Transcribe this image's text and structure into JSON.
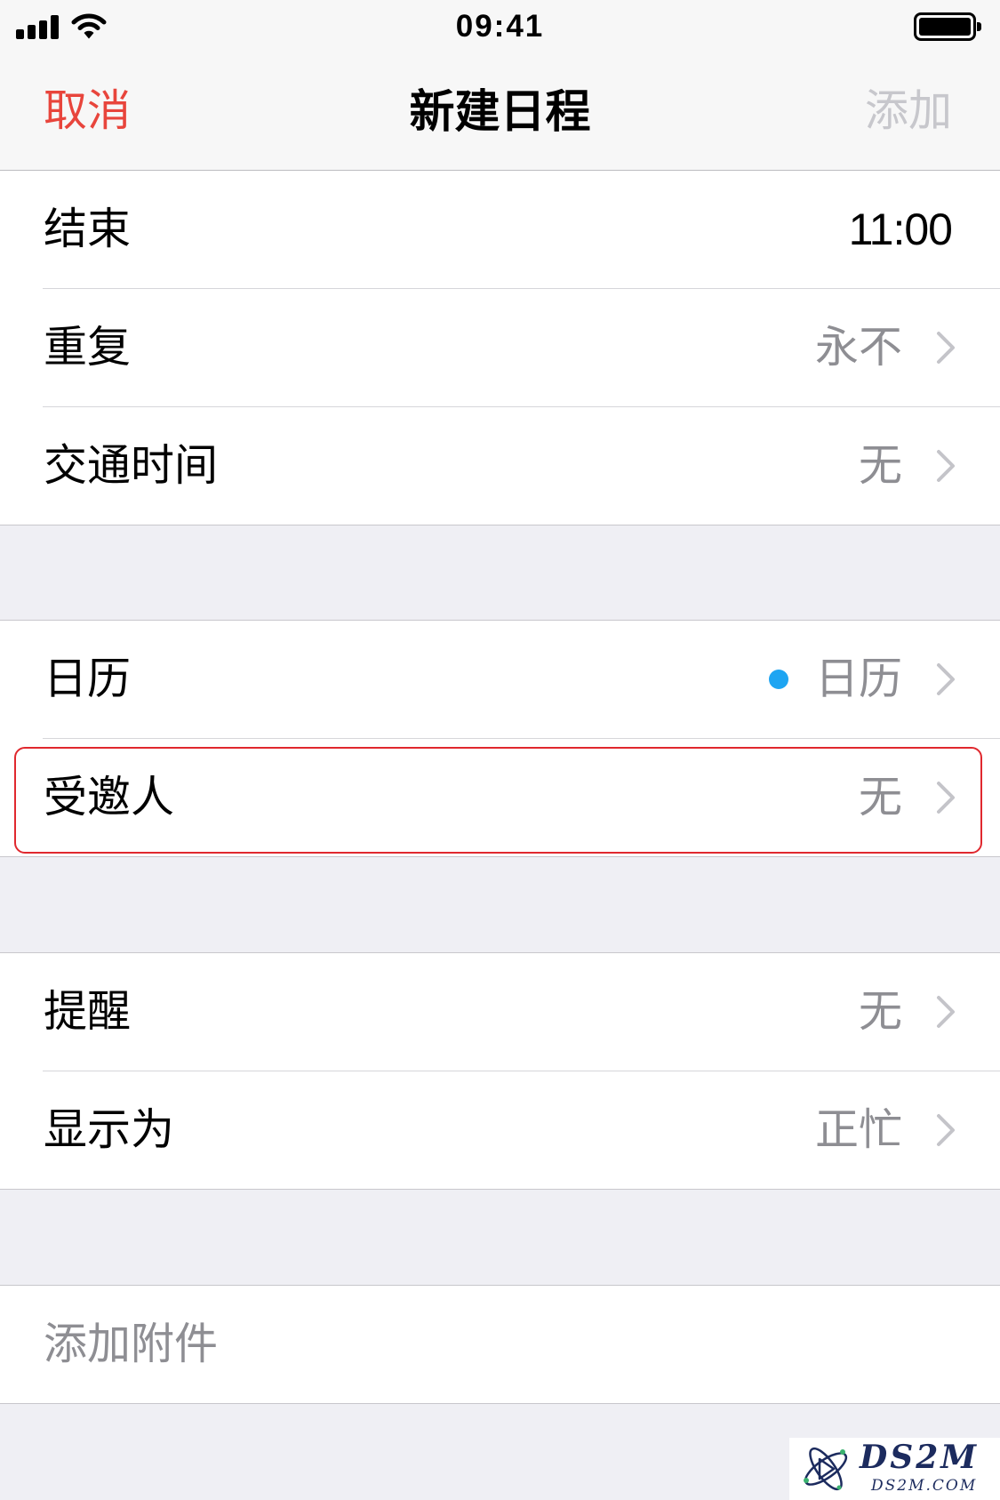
{
  "colors": {
    "accent_red": "#e8453c",
    "disabled_gray": "#c7c7cc",
    "value_gray": "#8e8e93",
    "calendar_dot": "#1ea5f2",
    "highlight_border": "#e0282e",
    "group_background": "#efeff4"
  },
  "status_bar": {
    "time": "09:41",
    "icons": [
      "signal-strength-icon",
      "wifi-icon",
      "battery-icon"
    ]
  },
  "nav": {
    "cancel_label": "取消",
    "title": "新建日程",
    "add_label": "添加"
  },
  "groups": [
    {
      "rows": [
        {
          "label": "结束",
          "value": "11:00"
        },
        {
          "label": "重复",
          "value": "永不",
          "icon": "chevron-right-icon"
        },
        {
          "label": "交通时间",
          "value": "无",
          "icon": "chevron-right-icon"
        }
      ]
    },
    {
      "rows": [
        {
          "label": "日历",
          "value": "日历",
          "icon": "chevron-right-icon",
          "marker_icon": "calendar-color-dot-icon"
        },
        {
          "label": "受邀人",
          "value": "无",
          "icon": "chevron-right-icon"
        }
      ]
    },
    {
      "rows": [
        {
          "label": "提醒",
          "value": "无",
          "icon": "chevron-right-icon"
        },
        {
          "label": "显示为",
          "value": "正忙",
          "icon": "chevron-right-icon"
        }
      ]
    },
    {
      "rows": [
        {
          "label": "添加附件"
        }
      ]
    }
  ],
  "watermark": {
    "logo_text": "DS2M",
    "site_text": "DS2M.COM"
  }
}
